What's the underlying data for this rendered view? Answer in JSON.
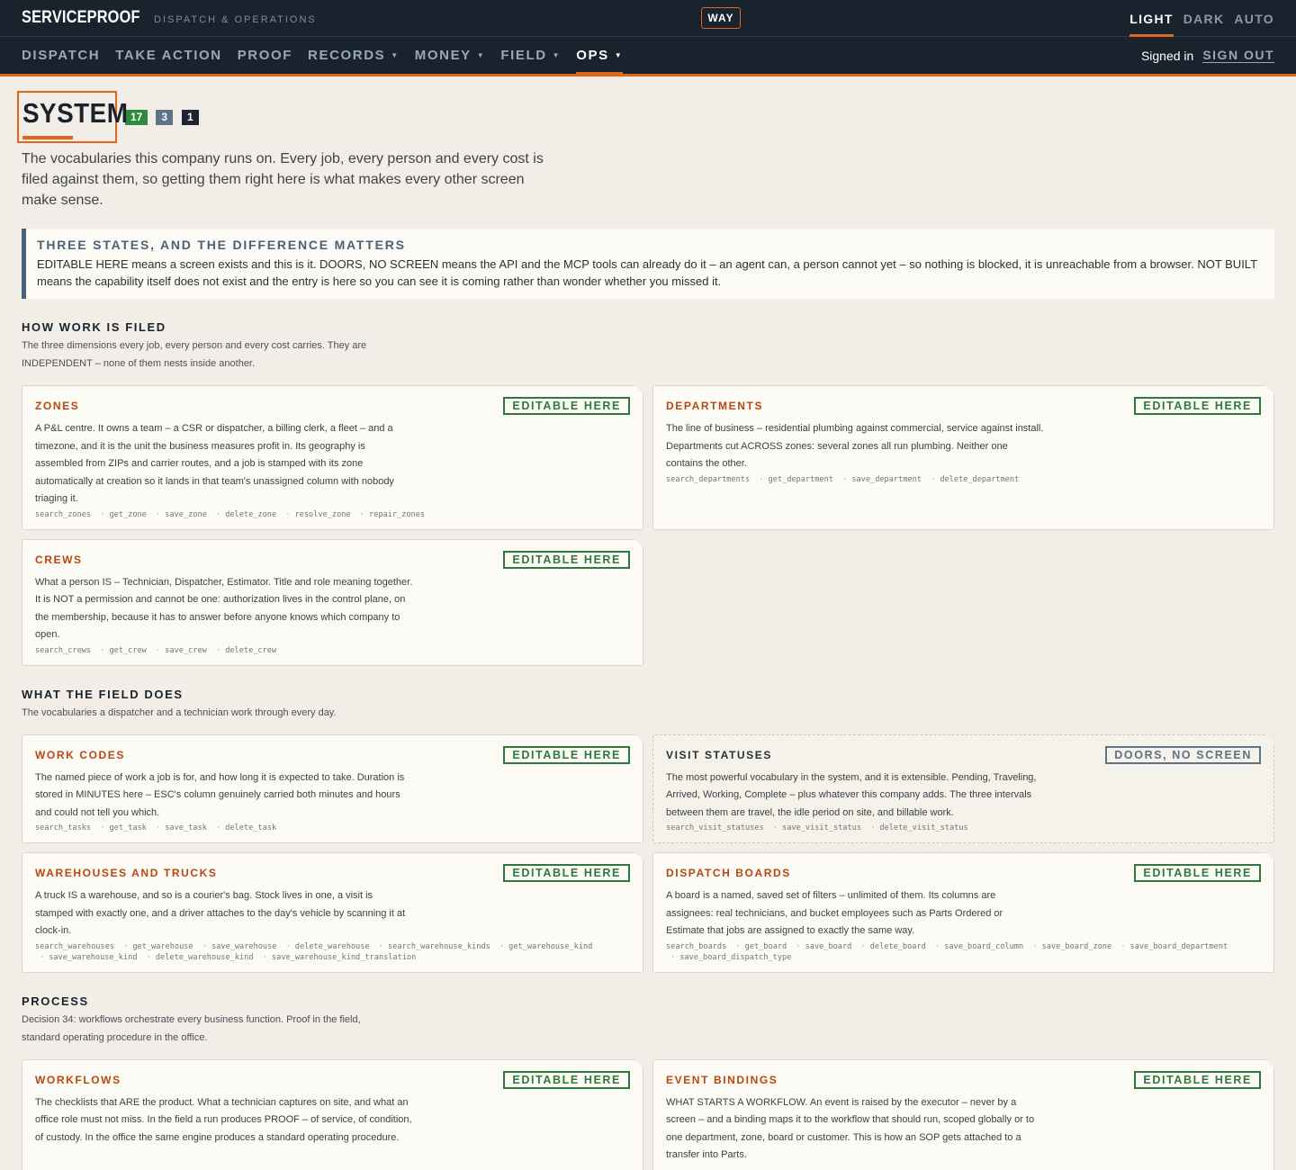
{
  "app": {
    "brand": "SERVICEPROOF",
    "brand_sub": "DISPATCH & OPERATIONS",
    "way_label": "WAY",
    "theme": {
      "light": "LIGHT",
      "dark": "DARK",
      "auto": "AUTO",
      "selected": "LIGHT"
    },
    "accent_color": "#e0661c"
  },
  "nav": {
    "items": [
      "DISPATCH",
      "TAKE ACTION",
      "PROOF",
      "RECORDS",
      "MONEY",
      "FIELD",
      "OPS"
    ],
    "active": "OPS",
    "signed_in": "Signed in",
    "sign_out": "SIGN OUT"
  },
  "page": {
    "title": "SYSTEM",
    "badges": [
      "17",
      "3",
      "1"
    ],
    "intro": "The vocabularies this company runs on. Every job, every person and every cost is filed against them, so getting them right here is what makes every other screen make sense."
  },
  "callout": {
    "title": "THREE STATES, AND THE DIFFERENCE MATTERS",
    "text": "EDITABLE HERE means a screen exists and this is it. DOORS, NO SCREEN means the API and the MCP tools can already do it – an agent can, a person cannot yet – so nothing is blocked, it is unreachable from a browser. NOT BUILT means the capability itself does not exist and the entry is here so you can see it is coming rather than wonder whether you missed it."
  },
  "sections": [
    {
      "title": "HOW WORK IS FILED",
      "desc": "The three dimensions every job, every person and every cost carries. They are INDEPENDENT – none of them nests inside another.",
      "cards": [
        {
          "title": "ZONES",
          "status": "EDITABLE HERE",
          "desc": "A P&L centre. It owns a team – a CSR or dispatcher, a billing clerk, a fleet – and a timezone, and it is the unit the business measures profit in. Its geography is assembled from ZIPs and carrier routes, and a job is stamped with its zone automatically at creation so it lands in that team's unassigned column with nobody triaging it.",
          "tools": [
            "search_zones",
            "get_zone",
            "save_zone",
            "delete_zone",
            "resolve_zone",
            "repair_zones"
          ]
        },
        {
          "title": "DEPARTMENTS",
          "status": "EDITABLE HERE",
          "desc": "The line of business – residential plumbing against commercial, service against install. Departments cut ACROSS zones: several zones all run plumbing. Neither one contains the other.",
          "tools": [
            "search_departments",
            "get_department",
            "save_department",
            "delete_department"
          ]
        },
        {
          "title": "CREWS",
          "status": "EDITABLE HERE",
          "desc": "What a person IS – Technician, Dispatcher, Estimator. Title and role meaning together. It is NOT a permission and cannot be one: authorization lives in the control plane, on the membership, because it has to answer before anyone knows which company to open.",
          "tools": [
            "search_crews",
            "get_crew",
            "save_crew",
            "delete_crew"
          ]
        }
      ]
    },
    {
      "title": "WHAT THE FIELD DOES",
      "desc": "The vocabularies a dispatcher and a technician work through every day.",
      "cards": [
        {
          "title": "WORK CODES",
          "status": "EDITABLE HERE",
          "desc": "The named piece of work a job is for, and how long it is expected to take. Duration is stored in MINUTES here – ESC's column genuinely carried both minutes and hours and could not tell you which.",
          "tools": [
            "search_tasks",
            "get_task",
            "save_task",
            "delete_task"
          ]
        },
        {
          "title": "VISIT STATUSES",
          "status": "DOORS, NO SCREEN",
          "desc": "The most powerful vocabulary in the system, and it is extensible. Pending, Traveling, Arrived, Working, Complete – plus whatever this company adds. The three intervals between them are travel, the idle period on site, and billable work.",
          "tools": [
            "search_visit_statuses",
            "save_visit_status",
            "delete_visit_status"
          ]
        },
        {
          "title": "WAREHOUSES AND TRUCKS",
          "status": "EDITABLE HERE",
          "desc": "A truck IS a warehouse, and so is a courier's bag. Stock lives in one, a visit is stamped with exactly one, and a driver attaches to the day's vehicle by scanning it at clock-in.",
          "tools": [
            "search_warehouses",
            "get_warehouse",
            "save_warehouse",
            "delete_warehouse",
            "search_warehouse_kinds",
            "get_warehouse_kind",
            "save_warehouse_kind",
            "delete_warehouse_kind",
            "save_warehouse_kind_translation"
          ]
        },
        {
          "title": "DISPATCH BOARDS",
          "status": "EDITABLE HERE",
          "desc": "A board is a named, saved set of filters – unlimited of them. Its columns are assignees: real technicians, and bucket employees such as Parts Ordered or Estimate that jobs are assigned to exactly the same way.",
          "tools": [
            "search_boards",
            "get_board",
            "save_board",
            "delete_board",
            "save_board_column",
            "save_board_zone",
            "save_board_department",
            "save_board_dispatch_type"
          ]
        }
      ]
    },
    {
      "title": "PROCESS",
      "desc": "Decision 34: workflows orchestrate every business function. Proof in the field, standard operating procedure in the office.",
      "cards": [
        {
          "title": "WORKFLOWS",
          "status": "EDITABLE HERE",
          "desc": "The checklists that ARE the product. What a technician captures on site, and what an office role must not miss. In the field a run produces PROOF – of service, of condition, of custody. In the office the same engine produces a standard operating procedure.",
          "tools": []
        },
        {
          "title": "EVENT BINDINGS",
          "status": "EDITABLE HERE",
          "desc": "WHAT STARTS A WORKFLOW. An event is raised by the executor – never by a screen – and a binding maps it to the workflow that should run, scoped globally or to one department, zone, board or customer. This is how an SOP gets attached to a transfer into Parts.",
          "tools": []
        }
      ]
    }
  ]
}
